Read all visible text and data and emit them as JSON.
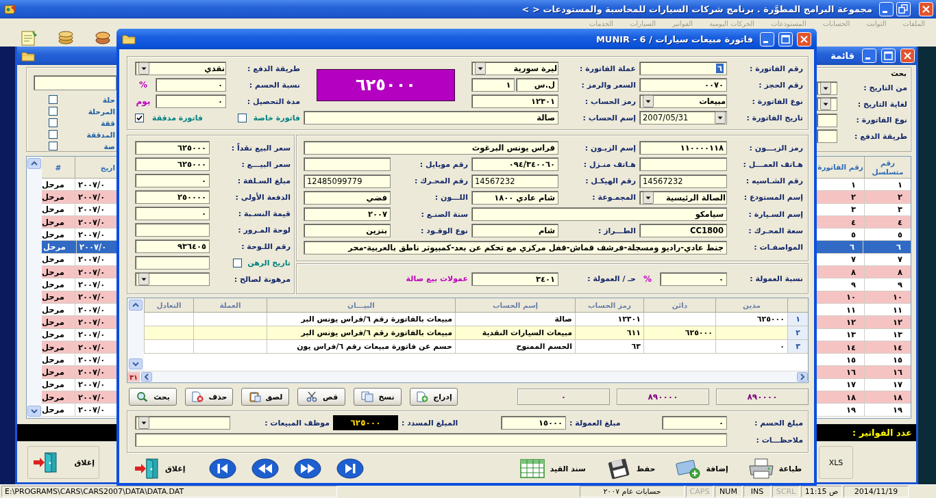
{
  "app": {
    "title": "مجموعة البرامج المطوَّرة . برنامج شركات السيارات للمحاسبة والمستودعات < >",
    "menu": [
      {
        "label": "الملفات",
        "disabled": true
      },
      {
        "label": "الثوابت",
        "disabled": true
      },
      {
        "label": "الحسابات",
        "disabled": true
      },
      {
        "label": "المستودعات",
        "disabled": true
      },
      {
        "label": "الحركات اليومية",
        "disabled": true
      },
      {
        "label": "الفواتير",
        "disabled": true
      },
      {
        "label": "السيارات",
        "disabled": true
      },
      {
        "label": "الخدمات",
        "disabled": true
      }
    ]
  },
  "list_window": {
    "title": "قائمة",
    "filter_options": [
      {
        "label": "حلة",
        "checked": false
      },
      {
        "label": "المرحلة",
        "checked": false
      },
      {
        "label": "ققة",
        "checked": false
      },
      {
        "label": "المدققة",
        "checked": false
      },
      {
        "label": "صة",
        "checked": false
      }
    ],
    "search": {
      "heading": "بحث",
      "fields": [
        {
          "label": "من التاريخ :",
          "kind": "dropdown"
        },
        {
          "label": "لغاية التاريخ :",
          "kind": "dropdown"
        },
        {
          "label": "نوع الفاتورة :",
          "kind": "text"
        },
        {
          "label": "طريقة الدفع :",
          "kind": "text"
        }
      ]
    },
    "table": {
      "columns": [
        "رقم متسلسل",
        "رقم الفاتورة",
        "اريخ",
        "#"
      ],
      "rows": [
        {
          "serial": "١",
          "invoice": "١",
          "date": "٢٠٠٧/٠",
          "status": "مرحل",
          "selected": false
        },
        {
          "serial": "٢",
          "invoice": "٢",
          "date": "٢٠٠٧/٠",
          "status": "مرحل",
          "selected": false
        },
        {
          "serial": "٣",
          "invoice": "٣",
          "date": "٢٠٠٧/٠",
          "status": "مرحل",
          "selected": false
        },
        {
          "serial": "٤",
          "invoice": "٤",
          "date": "٢٠٠٧/٠",
          "status": "مرحل",
          "selected": false
        },
        {
          "serial": "٥",
          "invoice": "٥",
          "date": "٢٠٠٧/٠",
          "status": "مرحل",
          "selected": false
        },
        {
          "serial": "٦",
          "invoice": "٦",
          "date": "٢٠٠٧/٠",
          "status": "مرحل",
          "selected": true
        },
        {
          "serial": "٧",
          "invoice": "٧",
          "date": "٢٠٠٧/٠",
          "status": "مرحل",
          "selected": false
        },
        {
          "serial": "٨",
          "invoice": "٨",
          "date": "٢٠٠٧/٠",
          "status": "مرحل",
          "selected": false
        },
        {
          "serial": "٩",
          "invoice": "٩",
          "date": "٢٠٠٧/٠",
          "status": "مرحل",
          "selected": false
        },
        {
          "serial": "١٠",
          "invoice": "١٠",
          "date": "٢٠٠٧/٠",
          "status": "مرحل",
          "selected": false
        },
        {
          "serial": "١١",
          "invoice": "١١",
          "date": "٢٠٠٧/٠",
          "status": "مرحل",
          "selected": false
        },
        {
          "serial": "١٢",
          "invoice": "١٢",
          "date": "٢٠٠٧/٠",
          "status": "مرحل",
          "selected": false
        },
        {
          "serial": "١٣",
          "invoice": "١٣",
          "date": "٢٠٠٧/٠",
          "status": "مرحل",
          "selected": false
        },
        {
          "serial": "١٤",
          "invoice": "١٤",
          "date": "٢٠٠٧/٠",
          "status": "مرحل",
          "selected": false
        },
        {
          "serial": "١٥",
          "invoice": "١٥",
          "date": "٢٠٠٧/٠",
          "status": "مرحل",
          "selected": false
        },
        {
          "serial": "١٦",
          "invoice": "١٦",
          "date": "٢٠٠٧/٠",
          "status": "مرحل",
          "selected": false
        },
        {
          "serial": "١٧",
          "invoice": "١٧",
          "date": "٢٠٠٧/٠",
          "status": "مرحل",
          "selected": false
        },
        {
          "serial": "١٨",
          "invoice": "١٨",
          "date": "٢٠٠٧/٠",
          "status": "مرحل",
          "selected": false
        },
        {
          "serial": "١٩",
          "invoice": "١٩",
          "date": "٢٠٠٧/٠",
          "status": "مرحل",
          "selected": false
        }
      ]
    },
    "count_label": "عدد الفواتير :",
    "close": {
      "label": "إغلاق"
    },
    "export": {
      "label": "XLS"
    }
  },
  "invoice_window": {
    "title": "فاتورة مبيعات سيارات / 6 - MUNIR",
    "header": {
      "columns": [
        [
          {
            "label": "رقم الفاتورة :",
            "value": "٦",
            "kind": "text",
            "highlighted": true
          },
          {
            "label": "رقم الحجز :",
            "value": "٠٠٧٠",
            "kind": "text"
          },
          {
            "label": "نوع الفاتورة :",
            "value": "مبيعات",
            "kind": "dropdown"
          },
          {
            "label": "تاريخ الفاتورة :",
            "value": "2007/05/31",
            "kind": "date"
          }
        ],
        [
          {
            "label": "عملة الفاتورة :",
            "value": "ليرة سورية",
            "kind": "dropdown"
          },
          {
            "label": "السعر والرمز :",
            "kind": "pair",
            "values": [
              "ل.س",
              "١"
            ]
          },
          {
            "label": "رمز الحساب :",
            "value": "١٢٣٠١",
            "kind": "text"
          },
          {
            "label": "إسم الحساب :",
            "value": "صالة",
            "kind": "text"
          }
        ],
        [
          {
            "label": "طريقة الدفع :",
            "value": "نقدي",
            "kind": "dropdown"
          },
          {
            "label": "نسبة الحسم :",
            "value": "٠",
            "kind": "text",
            "unit": "%"
          },
          {
            "label": "مدة التحصيل :",
            "value": "٠",
            "kind": "text",
            "unit": "يوم"
          }
        ]
      ],
      "total": "٦٢٥٠٠٠",
      "flags": [
        {
          "label": "فاتورة خاصة",
          "checked": false
        },
        {
          "label": "فاتورة مدققة",
          "checked": true
        }
      ]
    },
    "customer": {
      "rows": [
        [
          {
            "label": "رمز الزبـــون :",
            "value": "١١٠٠٠٠١١٨",
            "kind": "text"
          },
          {
            "label": "إسم الزبـون :",
            "value": "فراس يونس البرغوث",
            "kind": "text"
          }
        ],
        [
          {
            "label": "هـاتف العمـــل :",
            "kind": "text"
          },
          {
            "label": "هـاتف منـزل :",
            "value": "٠٩٤/٣٤٠٠٦٠",
            "kind": "text"
          },
          {
            "label": "رقم موبايل :",
            "kind": "text"
          }
        ],
        [
          {
            "label": "رقم الشـاسيه :",
            "value": "14567232",
            "kind": "ltr"
          },
          {
            "label": "رقم الهيكـل :",
            "value": "14567232",
            "kind": "ltr"
          },
          {
            "label": "رقم المحـرك :",
            "value": "12485099779",
            "kind": "ltr"
          }
        ],
        [
          {
            "label": "إسم المستودع :",
            "value": "الصالة الرئيسية",
            "kind": "dropdown"
          },
          {
            "label": "المجمـوعة :",
            "value": "شام عادي ١٨٠٠",
            "kind": "text"
          },
          {
            "label": "اللـــون :",
            "value": "فضي",
            "kind": "text"
          }
        ],
        [
          {
            "label": "إسم السـيارة :",
            "value": "سيامكو",
            "kind": "text"
          },
          "",
          {
            "label": "سنة الصنـع :",
            "value": "٢٠٠٧",
            "kind": "text"
          }
        ],
        [
          {
            "label": "سعة المحـرك :",
            "value": "CC1800",
            "kind": "text"
          },
          {
            "label": "الطـــراز :",
            "value": "شام",
            "kind": "text"
          },
          {
            "label": "نوع الوقـود :",
            "value": "بنزين",
            "kind": "text"
          }
        ],
        [
          {
            "label": "المواصفـات :",
            "value": "جنط عادي-راديو ومسجلة-فرشف قماش-قفل مركزي مع تحكم عن بعد-كمبيوتر ناطق بالعربية-محر",
            "kind": "text"
          }
        ]
      ]
    },
    "commission": {
      "fields": [
        {
          "label": "نسبة العمولة :",
          "value": "٠",
          "kind": "text",
          "unit": "%"
        },
        {
          "label": "حـ / العمولة :",
          "value": "٣٤٠١",
          "kind": "text"
        }
      ],
      "note": "عمولات بيع صالة"
    },
    "price": {
      "fields": [
        {
          "label": "سعر البيع نقداً :",
          "value": "٦٢٥٠٠٠",
          "kind": "text"
        },
        {
          "label": "سعر البيـــع :",
          "value": "٦٢٥٠٠٠",
          "kind": "text"
        },
        {
          "label": "مبلغ السـلفة :",
          "value": "٠",
          "kind": "text"
        },
        {
          "label": "الدفعة الأولى :",
          "value": "٢٥٠٠٠٠",
          "kind": "text"
        },
        {
          "label": "قيمة النسـبة :",
          "value": "٠",
          "kind": "text"
        },
        {
          "label": "لوحة المـرور :",
          "kind": "text"
        },
        {
          "label": "رقم اللـوحة :",
          "value": "٩٣٦٤٠٥",
          "kind": "text"
        },
        {
          "label": "تاريخ الرهن",
          "kind": "check",
          "checked": false
        },
        {
          "label": "مرهونة لصالح :",
          "kind": "dropdown"
        }
      ]
    },
    "entries": {
      "columns": [
        "مدين",
        "دائن",
        "رمز الحساب",
        "إسم الحساب",
        "البيـــان",
        "العملة",
        "التعادل"
      ],
      "rows": [
        {
          "number": "١",
          "debit": "٦٢٥٠٠٠",
          "account_code": "١٢٣٠١",
          "account_name": "صالة",
          "description": "مبيعات بالفاتورة رقم ٦/فراس يونس البر"
        },
        {
          "number": "٢",
          "credit": "٦٢٥٠٠٠",
          "account_code": "٦١١",
          "account_name": "مبيعات السيارات النقدية",
          "description": "مبيعات بالفاتورة رقم ٦/فراس يونس البر"
        },
        {
          "number": "٣",
          "debit": "٠",
          "account_code": "٦٣",
          "account_name": "الحسم الممنوح",
          "description": "حسم عن فاتورة مبيعات رقم ٦/فراس يون"
        }
      ],
      "counter": "٣١",
      "totals": [
        "٨٩٠٠٠٠",
        "٨٩٠٠٠٠",
        "٠"
      ]
    },
    "grid_buttons": [
      {
        "label": "إدراج",
        "kind": "insert"
      },
      {
        "label": "نسخ",
        "kind": "copy"
      },
      {
        "label": "قص",
        "kind": "cut"
      },
      {
        "label": "لصق",
        "kind": "paste"
      },
      {
        "label": "حذف",
        "kind": "delete"
      },
      {
        "label": "بحث",
        "kind": "search"
      }
    ],
    "summary": {
      "fields": [
        {
          "label": "مبلغ الحسم :",
          "value": "٠",
          "kind": "text"
        },
        {
          "label": "مبلغ العمولة :",
          "value": "١٥٠٠٠",
          "kind": "text"
        },
        {
          "label": "المبلغ المسدد :",
          "value": "٦٢٥٠٠٠",
          "kind": "display"
        },
        {
          "label": "موظف المبيعات :",
          "kind": "dropdown"
        }
      ],
      "notes": {
        "label": "ملاحظـــات :"
      }
    },
    "actions": [
      {
        "label": "طباعة",
        "kind": "print"
      },
      {
        "label": "إضافة",
        "kind": "add"
      },
      {
        "label": "حفظ",
        "kind": "save"
      },
      {
        "label": "سند القيد",
        "kind": "journal"
      }
    ],
    "close": {
      "label": "إغلاق"
    }
  },
  "status_bar": [
    {
      "text": "2014/11/19",
      "kind": "date"
    },
    {
      "text": "ص 11:15",
      "kind": "time"
    },
    {
      "text": "SCRL",
      "kind": "key",
      "on": false
    },
    {
      "text": "INS",
      "kind": "key",
      "on": true
    },
    {
      "text": "NUM",
      "kind": "key",
      "on": true
    },
    {
      "text": "CAPS",
      "kind": "key",
      "on": false
    },
    {
      "text": "حسابات عام ٢٠٠٧",
      "kind": "info"
    },
    {
      "text": "E:\\PROGRAMS\\CARS\\CARS2007\\DATA\\DATA.DAT",
      "kind": "path"
    }
  ]
}
